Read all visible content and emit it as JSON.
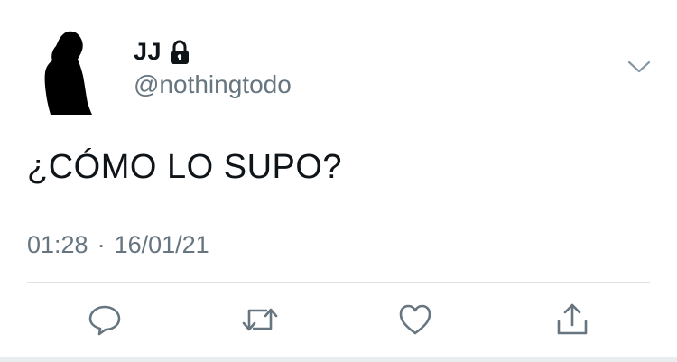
{
  "author": {
    "name": "JJ",
    "handle": "@nothingtodo",
    "avatar_icon": "silhouette-avatar",
    "protected_icon": "lock-icon"
  },
  "tweet": {
    "text": "¿CÓMO LO SUPO?",
    "time": "01:28",
    "separator": "·",
    "date": "16/01/21"
  },
  "menu_icon": "chevron-down-icon",
  "actions": [
    {
      "name": "reply",
      "icon": "reply-icon"
    },
    {
      "name": "retweet",
      "icon": "retweet-icon"
    },
    {
      "name": "like",
      "icon": "heart-icon"
    },
    {
      "name": "share",
      "icon": "share-icon"
    }
  ],
  "colors": {
    "text": "#0f1419",
    "secondary": "#66757f",
    "divider": "#dfe3e6"
  }
}
